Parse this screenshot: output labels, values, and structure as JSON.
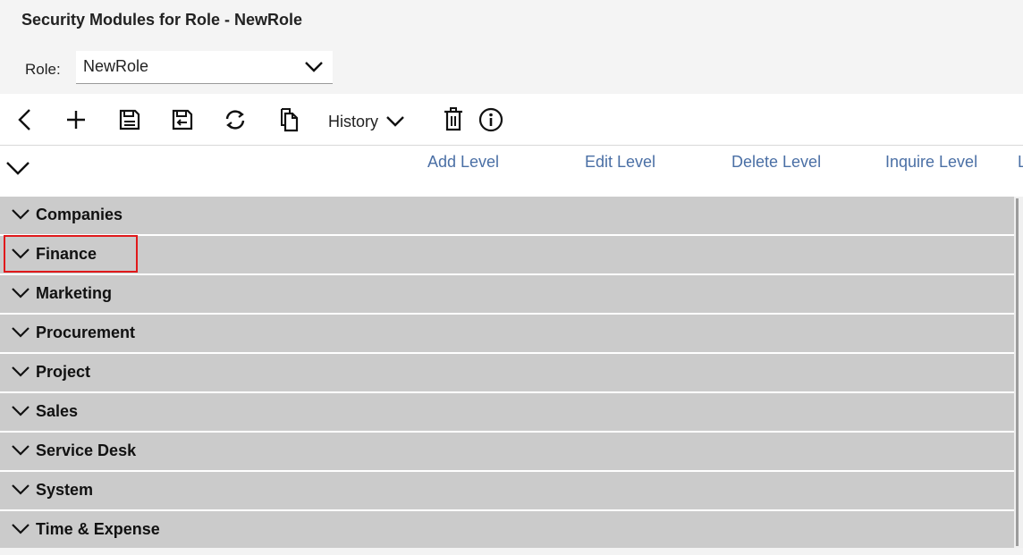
{
  "page": {
    "title": "Security Modules for Role - NewRole"
  },
  "role": {
    "label": "Role:",
    "value": "NewRole"
  },
  "toolbar": {
    "icons": [
      "back-icon",
      "add-icon",
      "save-icon",
      "save-and-close-icon",
      "refresh-icon",
      "copy-icon",
      "delete-icon",
      "info-icon"
    ],
    "history_label": "History"
  },
  "columns": {
    "add": "Add Level",
    "edit": "Edit Level",
    "delete": "Delete Level",
    "inquire": "Inquire Level",
    "truncated": "L"
  },
  "modules": [
    {
      "label": "Companies"
    },
    {
      "label": "Finance"
    },
    {
      "label": "Marketing"
    },
    {
      "label": "Procurement"
    },
    {
      "label": "Project"
    },
    {
      "label": "Sales"
    },
    {
      "label": "Service Desk"
    },
    {
      "label": "System"
    },
    {
      "label": "Time & Expense"
    }
  ],
  "colors": {
    "accent_link": "#4a6fa5",
    "row_bg": "#cbcbcb",
    "highlight": "#e0191b"
  }
}
